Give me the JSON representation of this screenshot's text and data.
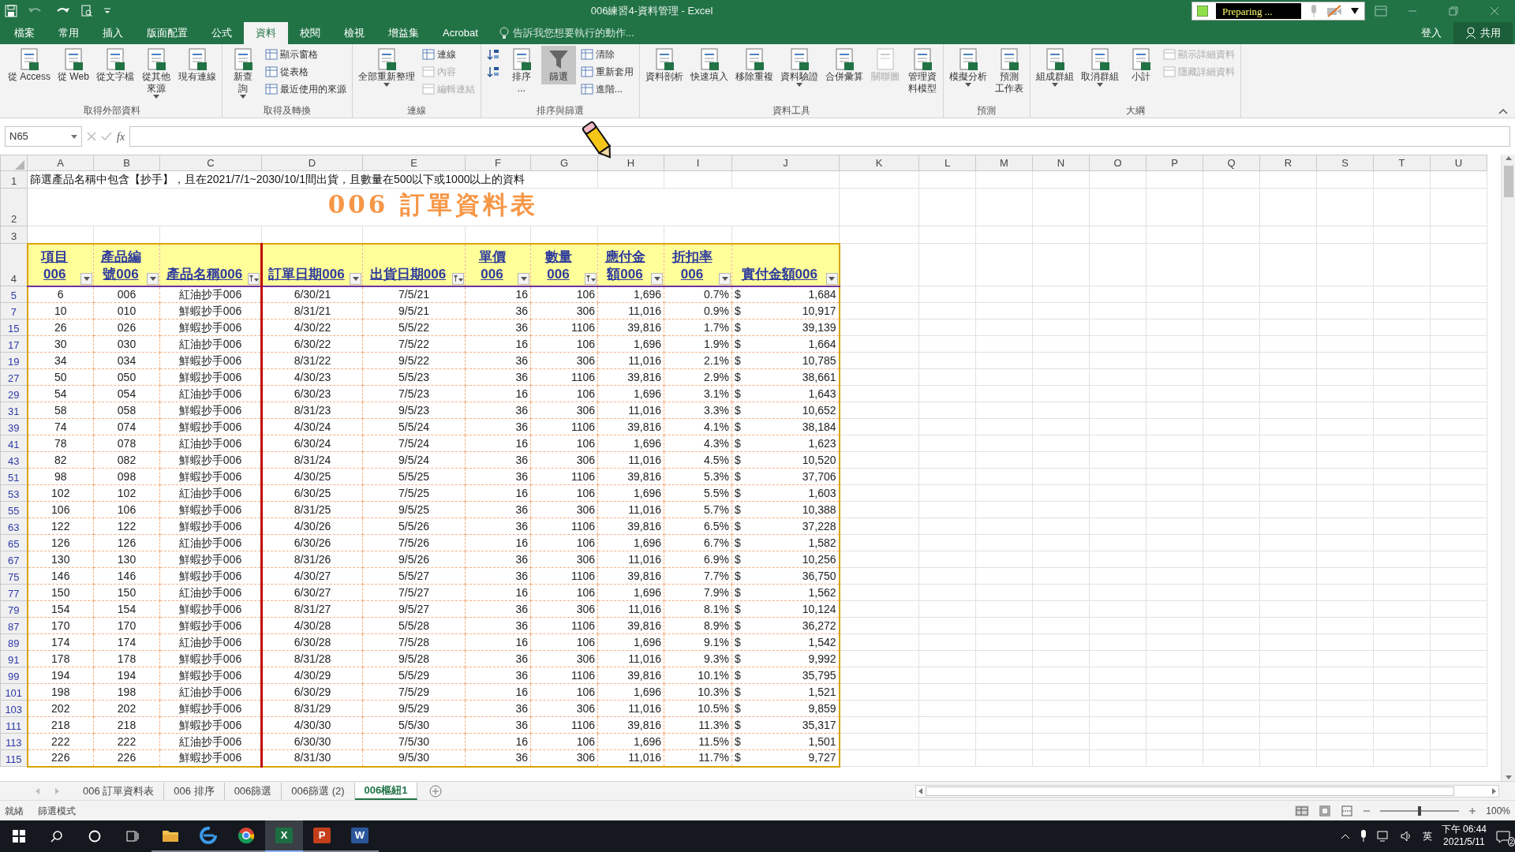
{
  "title_bar": {
    "title": "006練習4-資料管理 - Excel",
    "recorder": {
      "status": "Preparing ..."
    }
  },
  "menu_tabs": [
    {
      "label": "檔案",
      "selected": false
    },
    {
      "label": "常用",
      "selected": false
    },
    {
      "label": "插入",
      "selected": false
    },
    {
      "label": "版面配置",
      "selected": false
    },
    {
      "label": "公式",
      "selected": false
    },
    {
      "label": "資料",
      "selected": true
    },
    {
      "label": "校閱",
      "selected": false
    },
    {
      "label": "檢視",
      "selected": false
    },
    {
      "label": "增益集",
      "selected": false
    },
    {
      "label": "Acrobat",
      "selected": false
    }
  ],
  "tell_me": {
    "placeholder": "告訴我您想要執行的動作..."
  },
  "account": {
    "sign_in": "登入",
    "share": "共用"
  },
  "ribbon": {
    "groups": [
      {
        "label": "取得外部資料",
        "buttons": [
          {
            "kind": "large",
            "label": "從 Access",
            "dropdown": false,
            "selected": false,
            "disabled": false
          },
          {
            "kind": "large",
            "label": "從 Web",
            "dropdown": false,
            "selected": false,
            "disabled": false
          },
          {
            "kind": "large",
            "label": "從文字檔",
            "dropdown": false,
            "selected": false,
            "disabled": false
          },
          {
            "kind": "large",
            "label": [
              "從其他",
              "來源"
            ],
            "dropdown": true,
            "selected": false,
            "disabled": false
          },
          {
            "kind": "large",
            "label": "現有連線",
            "dropdown": false,
            "selected": false,
            "disabled": false
          }
        ]
      },
      {
        "label": "取得及轉換",
        "buttons": [
          {
            "kind": "large",
            "label": [
              "新查",
              "詢"
            ],
            "dropdown": true,
            "selected": false,
            "disabled": false
          },
          {
            "kind": "stack",
            "items": [
              {
                "label": "顯示窗格",
                "disabled": false
              },
              {
                "label": "從表格",
                "disabled": false
              },
              {
                "label": "最近使用的來源",
                "disabled": false
              }
            ]
          }
        ]
      },
      {
        "label": "連線",
        "buttons": [
          {
            "kind": "large",
            "label": "全部重新整理",
            "dropdown": true,
            "selected": false,
            "disabled": false
          },
          {
            "kind": "stack",
            "items": [
              {
                "label": "連線",
                "disabled": false
              },
              {
                "label": "內容",
                "disabled": true
              },
              {
                "label": "編輯連結",
                "disabled": true
              }
            ]
          }
        ]
      },
      {
        "label": "排序與篩選",
        "buttons": [
          {
            "kind": "stack",
            "items": [
              {
                "disabled": false
              },
              {
                "disabled": false
              }
            ]
          },
          {
            "kind": "large",
            "label": [
              "排序",
              "..."
            ],
            "dropdown": false,
            "selected": false,
            "disabled": false
          },
          {
            "kind": "large",
            "label": "篩選",
            "dropdown": false,
            "selected": true,
            "disabled": false
          },
          {
            "kind": "stack",
            "items": [
              {
                "label": "清除",
                "disabled": false
              },
              {
                "label": "重新套用",
                "disabled": false
              },
              {
                "label": "進階...",
                "disabled": false
              }
            ]
          }
        ]
      },
      {
        "label": "資料工具",
        "buttons": [
          {
            "kind": "large",
            "label": "資料剖析",
            "dropdown": false,
            "selected": false,
            "disabled": false
          },
          {
            "kind": "large",
            "label": "快速填入",
            "dropdown": false,
            "selected": false,
            "disabled": false
          },
          {
            "kind": "large",
            "label": "移除重複",
            "dropdown": false,
            "selected": false,
            "disabled": false
          },
          {
            "kind": "large",
            "label": "資料驗證",
            "dropdown": true,
            "selected": false,
            "disabled": false
          },
          {
            "kind": "large",
            "label": "合併彙算",
            "dropdown": false,
            "selected": false,
            "disabled": false
          },
          {
            "kind": "large",
            "label": "關聯圖",
            "dropdown": false,
            "selected": false,
            "disabled": true
          },
          {
            "kind": "large",
            "label": [
              "管理資",
              "料模型"
            ],
            "dropdown": false,
            "selected": false,
            "disabled": false
          }
        ]
      },
      {
        "label": "預測",
        "buttons": [
          {
            "kind": "large",
            "label": "模擬分析",
            "dropdown": true,
            "selected": false,
            "disabled": false
          },
          {
            "kind": "large",
            "label": [
              "預測",
              "工作表"
            ],
            "dropdown": false,
            "selected": false,
            "disabled": false
          }
        ]
      },
      {
        "label": "大綱",
        "buttons": [
          {
            "kind": "large",
            "label": "組成群組",
            "dropdown": true,
            "selected": false,
            "disabled": false
          },
          {
            "kind": "large",
            "label": "取消群組",
            "dropdown": true,
            "selected": false,
            "disabled": false
          },
          {
            "kind": "large",
            "label": "小計",
            "dropdown": false,
            "selected": false,
            "disabled": false
          },
          {
            "kind": "stack",
            "items": [
              {
                "label": "顯示詳細資料",
                "disabled": true
              },
              {
                "label": "隱藏詳細資料",
                "disabled": true
              }
            ]
          }
        ]
      }
    ]
  },
  "formula_bar": {
    "name_box": "N65",
    "function_label": "fx"
  },
  "sheet": {
    "columns": [
      "A",
      "B",
      "C",
      "D",
      "E",
      "F",
      "G",
      "H",
      "I",
      "J",
      "K",
      "L",
      "M",
      "N",
      "O",
      "P",
      "Q",
      "R",
      "S",
      "T",
      "U"
    ],
    "note_row": {
      "row": "1",
      "text": "篩選產品名稱中包含【抄手】，且在2021/7/1~2030/10/1間出貨，且數量在500以下或1000以上的資料"
    },
    "title_row": {
      "row": "2",
      "text": "006 訂單資料表"
    },
    "blank_row": {
      "row": "3"
    },
    "header_row": {
      "row": "4",
      "headers": [
        {
          "label": "項目006",
          "filtered": false
        },
        {
          "label": [
            "產品編",
            "號006"
          ],
          "filtered": false
        },
        {
          "label": "產品名稱006",
          "filtered": true
        },
        {
          "label": "訂單日期006",
          "filtered": false
        },
        {
          "label": "出貨日期006",
          "filtered": true
        },
        {
          "label": [
            "單價",
            "006"
          ],
          "filtered": false
        },
        {
          "label": [
            "數量",
            "006"
          ],
          "filtered": true
        },
        {
          "label": [
            "應付金",
            "額006"
          ],
          "filtered": false
        },
        {
          "label": [
            "折扣率",
            "006"
          ],
          "filtered": false
        },
        {
          "label": "實付金額006",
          "filtered": false
        }
      ]
    },
    "rows": [
      {
        "row": "5",
        "cells": [
          "6",
          "006",
          "紅油抄手006",
          "6/30/21",
          "7/5/21",
          "16",
          "106",
          "1,696",
          "0.7%",
          {
            "symbol": "$",
            "amount": "1,684"
          }
        ]
      },
      {
        "row": "7",
        "cells": [
          "10",
          "010",
          "鮮蝦抄手006",
          "8/31/21",
          "9/5/21",
          "36",
          "306",
          "11,016",
          "0.9%",
          {
            "symbol": "$",
            "amount": "10,917"
          }
        ]
      },
      {
        "row": "15",
        "cells": [
          "26",
          "026",
          "鮮蝦抄手006",
          "4/30/22",
          "5/5/22",
          "36",
          "1106",
          "39,816",
          "1.7%",
          {
            "symbol": "$",
            "amount": "39,139"
          }
        ]
      },
      {
        "row": "17",
        "cells": [
          "30",
          "030",
          "紅油抄手006",
          "6/30/22",
          "7/5/22",
          "16",
          "106",
          "1,696",
          "1.9%",
          {
            "symbol": "$",
            "amount": "1,664"
          }
        ]
      },
      {
        "row": "19",
        "cells": [
          "34",
          "034",
          "鮮蝦抄手006",
          "8/31/22",
          "9/5/22",
          "36",
          "306",
          "11,016",
          "2.1%",
          {
            "symbol": "$",
            "amount": "10,785"
          }
        ]
      },
      {
        "row": "27",
        "cells": [
          "50",
          "050",
          "鮮蝦抄手006",
          "4/30/23",
          "5/5/23",
          "36",
          "1106",
          "39,816",
          "2.9%",
          {
            "symbol": "$",
            "amount": "38,661"
          }
        ]
      },
      {
        "row": "29",
        "cells": [
          "54",
          "054",
          "紅油抄手006",
          "6/30/23",
          "7/5/23",
          "16",
          "106",
          "1,696",
          "3.1%",
          {
            "symbol": "$",
            "amount": "1,643"
          }
        ]
      },
      {
        "row": "31",
        "cells": [
          "58",
          "058",
          "鮮蝦抄手006",
          "8/31/23",
          "9/5/23",
          "36",
          "306",
          "11,016",
          "3.3%",
          {
            "symbol": "$",
            "amount": "10,652"
          }
        ]
      },
      {
        "row": "39",
        "cells": [
          "74",
          "074",
          "鮮蝦抄手006",
          "4/30/24",
          "5/5/24",
          "36",
          "1106",
          "39,816",
          "4.1%",
          {
            "symbol": "$",
            "amount": "38,184"
          }
        ]
      },
      {
        "row": "41",
        "cells": [
          "78",
          "078",
          "紅油抄手006",
          "6/30/24",
          "7/5/24",
          "16",
          "106",
          "1,696",
          "4.3%",
          {
            "symbol": "$",
            "amount": "1,623"
          }
        ]
      },
      {
        "row": "43",
        "cells": [
          "82",
          "082",
          "鮮蝦抄手006",
          "8/31/24",
          "9/5/24",
          "36",
          "306",
          "11,016",
          "4.5%",
          {
            "symbol": "$",
            "amount": "10,520"
          }
        ]
      },
      {
        "row": "51",
        "cells": [
          "98",
          "098",
          "鮮蝦抄手006",
          "4/30/25",
          "5/5/25",
          "36",
          "1106",
          "39,816",
          "5.3%",
          {
            "symbol": "$",
            "amount": "37,706"
          }
        ]
      },
      {
        "row": "53",
        "cells": [
          "102",
          "102",
          "紅油抄手006",
          "6/30/25",
          "7/5/25",
          "16",
          "106",
          "1,696",
          "5.5%",
          {
            "symbol": "$",
            "amount": "1,603"
          }
        ]
      },
      {
        "row": "55",
        "cells": [
          "106",
          "106",
          "鮮蝦抄手006",
          "8/31/25",
          "9/5/25",
          "36",
          "306",
          "11,016",
          "5.7%",
          {
            "symbol": "$",
            "amount": "10,388"
          }
        ]
      },
      {
        "row": "63",
        "cells": [
          "122",
          "122",
          "鮮蝦抄手006",
          "4/30/26",
          "5/5/26",
          "36",
          "1106",
          "39,816",
          "6.5%",
          {
            "symbol": "$",
            "amount": "37,228"
          }
        ]
      },
      {
        "row": "65",
        "cells": [
          "126",
          "126",
          "紅油抄手006",
          "6/30/26",
          "7/5/26",
          "16",
          "106",
          "1,696",
          "6.7%",
          {
            "symbol": "$",
            "amount": "1,582"
          }
        ]
      },
      {
        "row": "67",
        "cells": [
          "130",
          "130",
          "鮮蝦抄手006",
          "8/31/26",
          "9/5/26",
          "36",
          "306",
          "11,016",
          "6.9%",
          {
            "symbol": "$",
            "amount": "10,256"
          }
        ]
      },
      {
        "row": "75",
        "cells": [
          "146",
          "146",
          "鮮蝦抄手006",
          "4/30/27",
          "5/5/27",
          "36",
          "1106",
          "39,816",
          "7.7%",
          {
            "symbol": "$",
            "amount": "36,750"
          }
        ]
      },
      {
        "row": "77",
        "cells": [
          "150",
          "150",
          "紅油抄手006",
          "6/30/27",
          "7/5/27",
          "16",
          "106",
          "1,696",
          "7.9%",
          {
            "symbol": "$",
            "amount": "1,562"
          }
        ]
      },
      {
        "row": "79",
        "cells": [
          "154",
          "154",
          "鮮蝦抄手006",
          "8/31/27",
          "9/5/27",
          "36",
          "306",
          "11,016",
          "8.1%",
          {
            "symbol": "$",
            "amount": "10,124"
          }
        ]
      },
      {
        "row": "87",
        "cells": [
          "170",
          "170",
          "鮮蝦抄手006",
          "4/30/28",
          "5/5/28",
          "36",
          "1106",
          "39,816",
          "8.9%",
          {
            "symbol": "$",
            "amount": "36,272"
          }
        ]
      },
      {
        "row": "89",
        "cells": [
          "174",
          "174",
          "紅油抄手006",
          "6/30/28",
          "7/5/28",
          "16",
          "106",
          "1,696",
          "9.1%",
          {
            "symbol": "$",
            "amount": "1,542"
          }
        ]
      },
      {
        "row": "91",
        "cells": [
          "178",
          "178",
          "鮮蝦抄手006",
          "8/31/28",
          "9/5/28",
          "36",
          "306",
          "11,016",
          "9.3%",
          {
            "symbol": "$",
            "amount": "9,992"
          }
        ]
      },
      {
        "row": "99",
        "cells": [
          "194",
          "194",
          "鮮蝦抄手006",
          "4/30/29",
          "5/5/29",
          "36",
          "1106",
          "39,816",
          "10.1%",
          {
            "symbol": "$",
            "amount": "35,795"
          }
        ]
      },
      {
        "row": "101",
        "cells": [
          "198",
          "198",
          "紅油抄手006",
          "6/30/29",
          "7/5/29",
          "16",
          "106",
          "1,696",
          "10.3%",
          {
            "symbol": "$",
            "amount": "1,521"
          }
        ]
      },
      {
        "row": "103",
        "cells": [
          "202",
          "202",
          "鮮蝦抄手006",
          "8/31/29",
          "9/5/29",
          "36",
          "306",
          "11,016",
          "10.5%",
          {
            "symbol": "$",
            "amount": "9,859"
          }
        ]
      },
      {
        "row": "111",
        "cells": [
          "218",
          "218",
          "鮮蝦抄手006",
          "4/30/30",
          "5/5/30",
          "36",
          "1106",
          "39,816",
          "11.3%",
          {
            "symbol": "$",
            "amount": "35,317"
          }
        ]
      },
      {
        "row": "113",
        "cells": [
          "222",
          "222",
          "紅油抄手006",
          "6/30/30",
          "7/5/30",
          "16",
          "106",
          "1,696",
          "11.5%",
          {
            "symbol": "$",
            "amount": "1,501"
          }
        ]
      },
      {
        "row": "115",
        "cells": [
          "226",
          "226",
          "鮮蝦抄手006",
          "8/31/30",
          "9/5/30",
          "36",
          "306",
          "11,016",
          "11.7%",
          {
            "symbol": "$",
            "amount": "9,727"
          }
        ]
      }
    ]
  },
  "sheet_tabs": [
    {
      "label": "006 訂單資料表",
      "selected": false
    },
    {
      "label": "006 排序",
      "selected": false
    },
    {
      "label": "006篩選",
      "selected": false
    },
    {
      "label": "006篩選 (2)",
      "selected": false
    },
    {
      "label": "006樞紐1",
      "selected": true
    }
  ],
  "status_bar": {
    "ready": "就緒",
    "mode": "篩選模式",
    "zoom": "100%",
    "level": 0.5
  },
  "taskbar": {
    "apps": [
      {
        "kind": "explorer",
        "selected": false
      },
      {
        "kind": "edge",
        "selected": false
      },
      {
        "kind": "chrome",
        "selected": false
      },
      {
        "kind": "office",
        "label": "X",
        "color": "#1d6f42",
        "selected": true
      },
      {
        "kind": "office",
        "label": "P",
        "color": "#c43e1c",
        "selected": false
      },
      {
        "kind": "office",
        "label": "W",
        "color": "#2b579a",
        "selected": false
      }
    ],
    "ime": "英",
    "time": "下午 06:44",
    "date": "2021/5/11",
    "notifications": "2"
  }
}
